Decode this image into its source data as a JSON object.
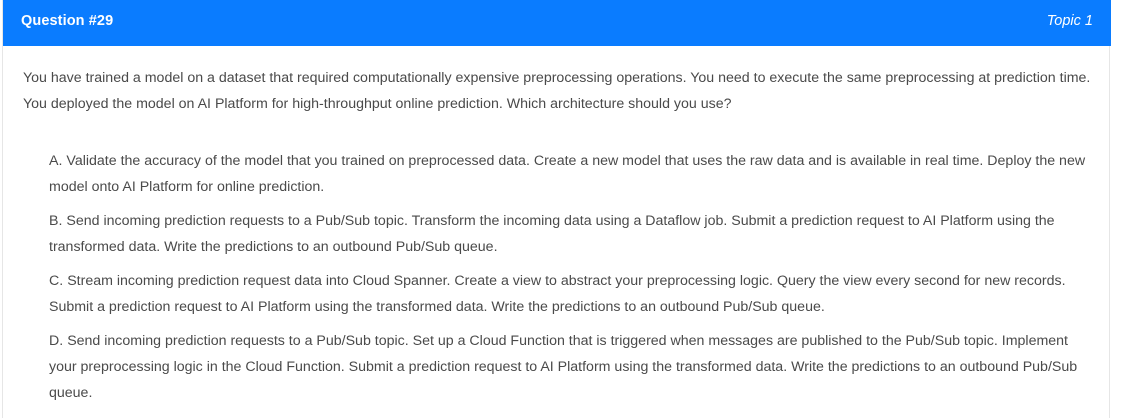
{
  "header": {
    "question_label": "Question #29",
    "topic_label": "Topic 1",
    "accent_color": "#0a7cff"
  },
  "question": {
    "text": "You have trained a model on a dataset that required computationally expensive preprocessing operations. You need to execute the same preprocessing at prediction time. You deployed the model on AI Platform for high-throughput online prediction. Which architecture should you use?"
  },
  "choices": [
    {
      "letter": "A.",
      "text": "Validate the accuracy of the model that you trained on preprocessed data. Create a new model that uses the raw data and is available in real time. Deploy the new model onto AI Platform for online prediction."
    },
    {
      "letter": "B.",
      "text": "Send incoming prediction requests to a Pub/Sub topic. Transform the incoming data using a Dataflow job. Submit a prediction request to AI Platform using the transformed data. Write the predictions to an outbound Pub/Sub queue."
    },
    {
      "letter": "C.",
      "text": "Stream incoming prediction request data into Cloud Spanner. Create a view to abstract your preprocessing logic. Query the view every second for new records. Submit a prediction request to AI Platform using the transformed data. Write the predictions to an outbound Pub/Sub queue."
    },
    {
      "letter": "D.",
      "text": "Send incoming prediction requests to a Pub/Sub topic. Set up a Cloud Function that is triggered when messages are published to the Pub/Sub topic. Implement your preprocessing logic in the Cloud Function. Submit a prediction request to AI Platform using the transformed data. Write the predictions to an outbound Pub/Sub queue."
    }
  ]
}
